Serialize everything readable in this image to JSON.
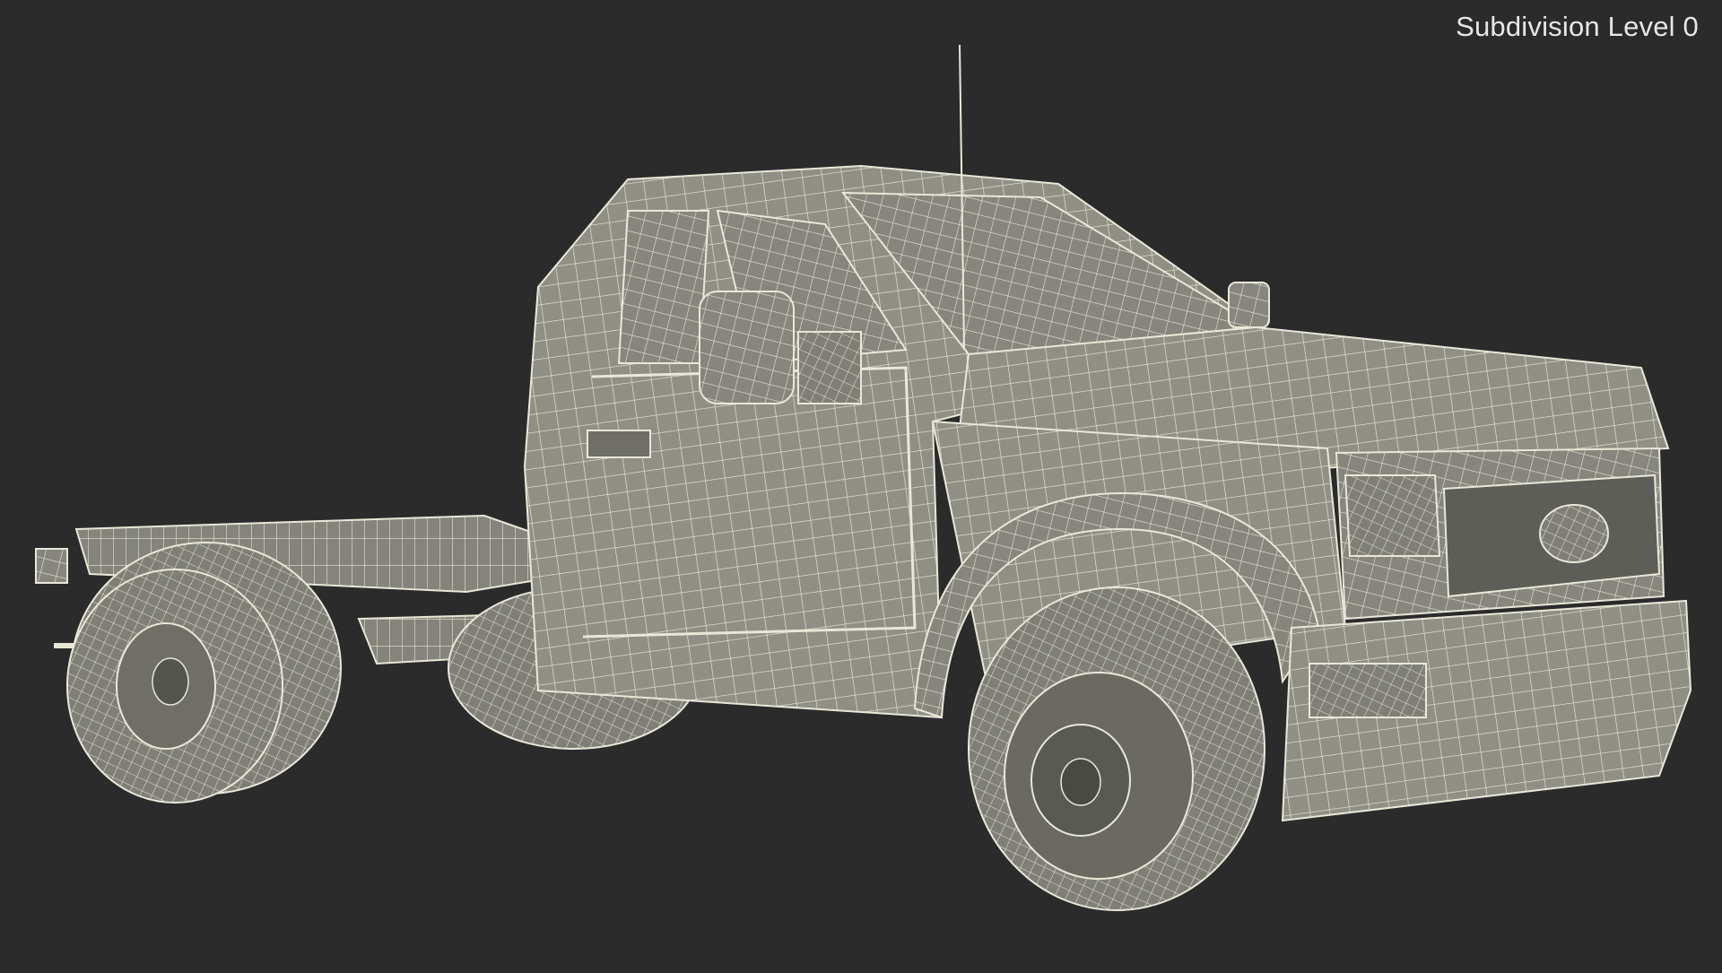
{
  "viewport": {
    "background": "#2b2b2b",
    "subdivision_label": "Subdivision Level 0"
  },
  "model": {
    "render_style": "wireframe",
    "surface_color": "#8f8f86",
    "wire_color": "#e9e7d8",
    "components": [
      "cab",
      "hood",
      "grille",
      "front-bumper",
      "front-wheel",
      "rear-dual-wheels",
      "chassis-frame",
      "side-mirror",
      "antenna"
    ]
  }
}
